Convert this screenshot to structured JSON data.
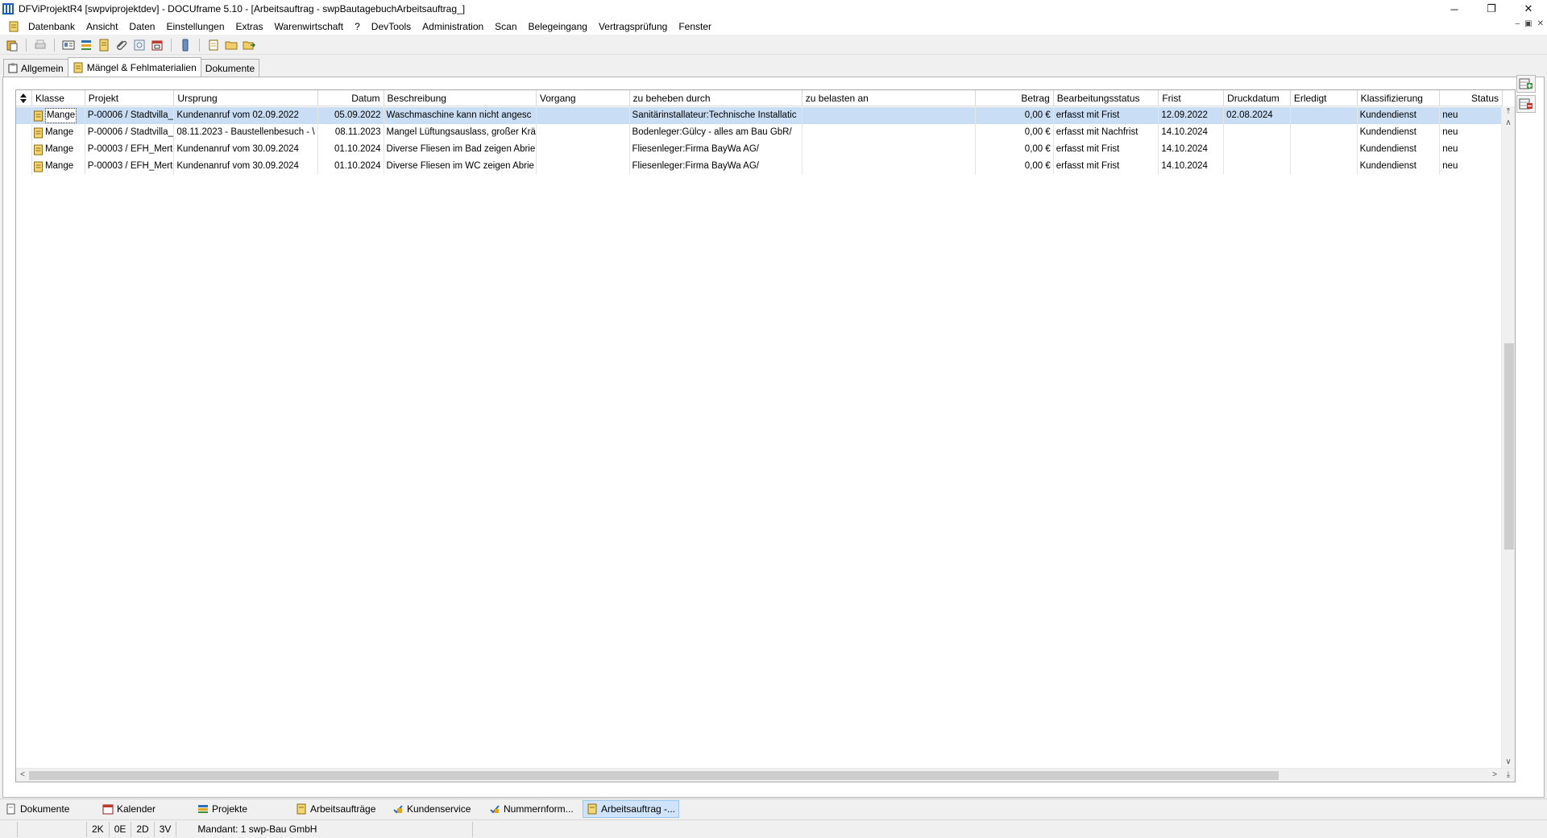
{
  "window": {
    "title": "DFViProjektR4 [swpviprojektdev] - DOCUframe 5.10 - [Arbeitsauftrag - swpBautagebuchArbeitsauftrag_]",
    "controls": [
      "─",
      "❐",
      "✕"
    ]
  },
  "menu": {
    "items": [
      "Datenbank",
      "Ansicht",
      "Daten",
      "Einstellungen",
      "Extras",
      "Warenwirtschaft",
      "?",
      "DevTools",
      "Administration",
      "Scan",
      "Belegeingang",
      "Vertragsprüfung",
      "Fenster"
    ],
    "mdi_controls": [
      "–",
      "▣",
      "✕"
    ]
  },
  "tabs": [
    {
      "label": "Allgemein",
      "icon": "clipboard-icon"
    },
    {
      "label": "Mängel & Fehlmaterialien",
      "icon": "defect-doc-icon",
      "active": true
    },
    {
      "label": "Dokumente",
      "icon": ""
    }
  ],
  "grid": {
    "columns": [
      {
        "label": "Klasse"
      },
      {
        "label": "Projekt"
      },
      {
        "label": "Ursprung"
      },
      {
        "label": "Datum",
        "align": "right"
      },
      {
        "label": "Beschreibung"
      },
      {
        "label": "Vorgang"
      },
      {
        "label": "zu beheben durch"
      },
      {
        "label": "zu belasten an"
      },
      {
        "label": "Betrag",
        "align": "right"
      },
      {
        "label": "Bearbeitungsstatus"
      },
      {
        "label": "Frist"
      },
      {
        "label": "Druckdatum"
      },
      {
        "label": "Erledigt"
      },
      {
        "label": "Klassifizierung"
      },
      {
        "label": "Status",
        "align": "right"
      }
    ],
    "rows": [
      {
        "cells": [
          "Mange",
          "P-00006 / Stadtvilla_",
          "Kundenanruf vom 02.09.2022",
          "05.09.2022",
          "Waschmaschine kann nicht angesc",
          "",
          "Sanitärinstallateur:Technische Installatic",
          "",
          "0,00 €",
          "erfasst mit Frist",
          "12.09.2022",
          "02.08.2024",
          "",
          "Kundendienst",
          "neu"
        ],
        "selected": true
      },
      {
        "cells": [
          "Mange",
          "P-00006 / Stadtvilla_",
          "08.11.2023 - Baustellenbesuch - \\",
          "08.11.2023",
          "Mangel Lüftungsauslass, großer Krä",
          "",
          "Bodenleger:Gülcy - alles am Bau GbR/",
          "",
          "0,00 €",
          "erfasst mit Nachfrist",
          "14.10.2024",
          "",
          "",
          "Kundendienst",
          "neu"
        ]
      },
      {
        "cells": [
          "Mange",
          "P-00003 / EFH_Mert«",
          "Kundenanruf vom 30.09.2024",
          "01.10.2024",
          "Diverse Fliesen im Bad zeigen Abrie",
          "",
          "Fliesenleger:Firma BayWa AG/",
          "",
          "0,00 €",
          "erfasst mit Frist",
          "14.10.2024",
          "",
          "",
          "Kundendienst",
          "neu"
        ]
      },
      {
        "cells": [
          "Mange",
          "P-00003 / EFH_Mert«",
          "Kundenanruf vom 30.09.2024",
          "01.10.2024",
          "Diverse Fliesen im WC zeigen Abrie",
          "",
          "Fliesenleger:Firma BayWa AG/",
          "",
          "0,00 €",
          "erfasst mit Frist",
          "14.10.2024",
          "",
          "",
          "Kundendienst",
          "neu"
        ]
      }
    ]
  },
  "taskbar": [
    {
      "label": "Dokumente",
      "icon": "documents-icon"
    },
    {
      "label": "Kalender",
      "icon": "calendar-icon"
    },
    {
      "label": "Projekte",
      "icon": "projects-icon"
    },
    {
      "label": "Arbeitsaufträge",
      "icon": "work-orders-icon"
    },
    {
      "label": "Kundenservice",
      "icon": "customer-service-icon"
    },
    {
      "label": "Nummernform...",
      "icon": "number-format-icon"
    },
    {
      "label": "Arbeitsauftrag -...",
      "icon": "work-order-icon",
      "active": true
    }
  ],
  "status": {
    "counters": [
      "2K",
      "0E",
      "2D",
      "3V"
    ],
    "mandant": "Mandant: 1 swp-Bau GmbH"
  },
  "colors": {
    "selection": "#c9def5",
    "active_task": "#cfe4fa"
  }
}
